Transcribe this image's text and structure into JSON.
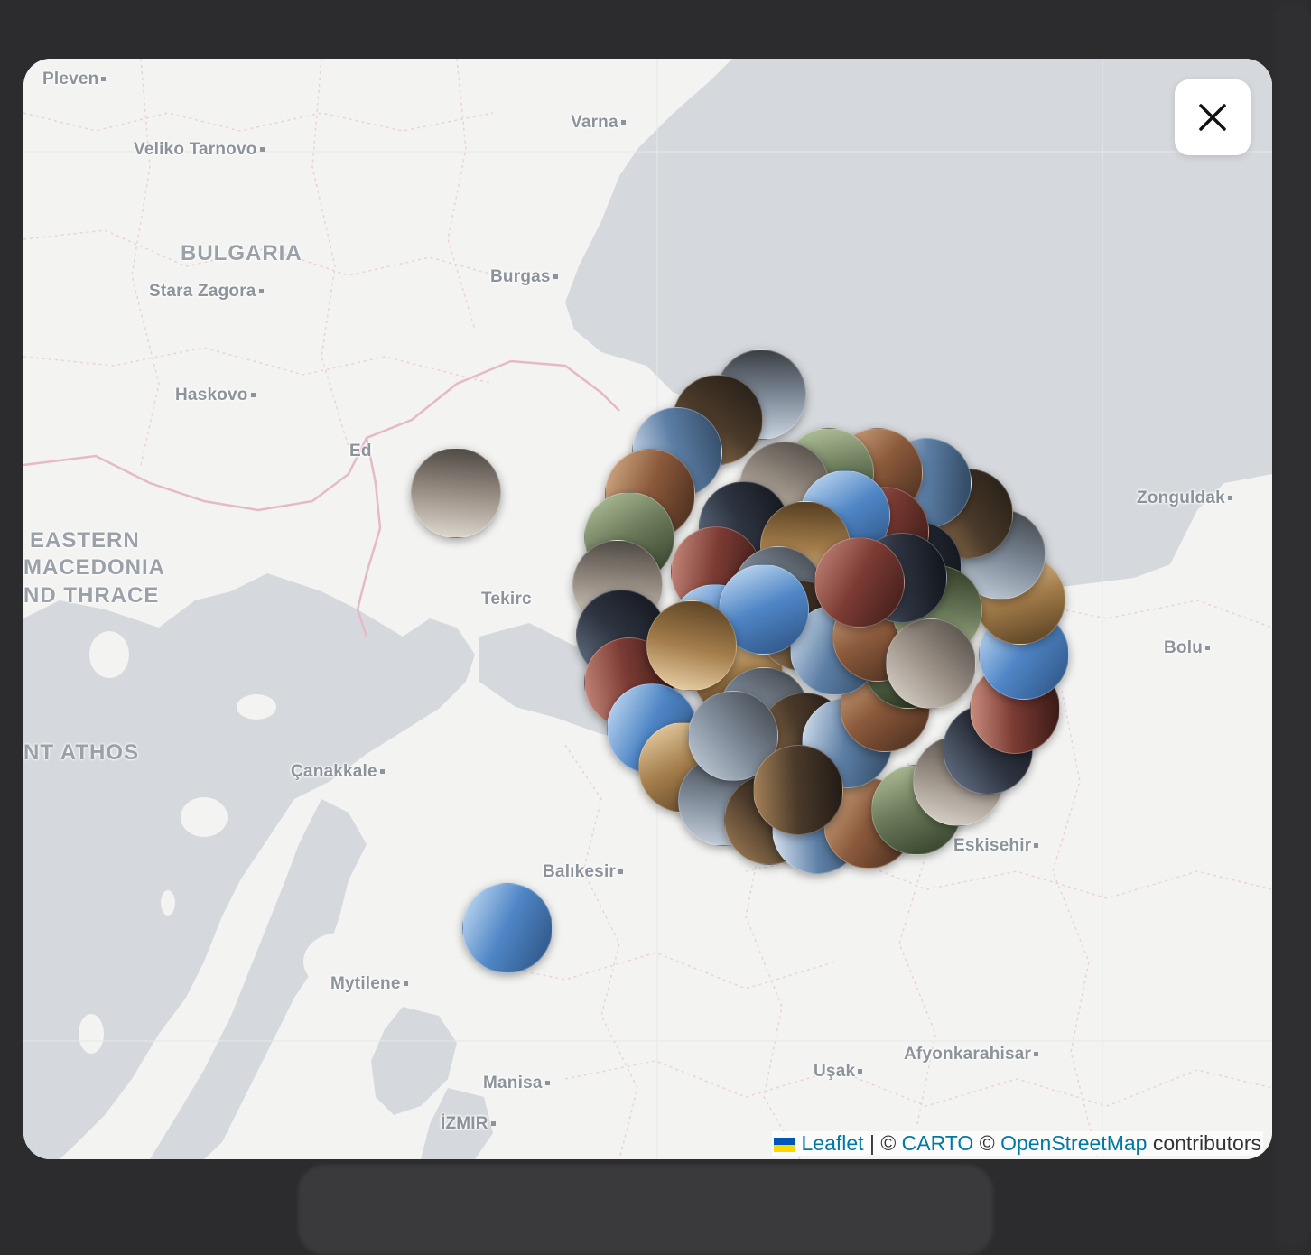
{
  "modal": {
    "close_label": "Close"
  },
  "map": {
    "cities": [
      {
        "key": "pleven",
        "name": "Pleven"
      },
      {
        "key": "varna",
        "name": "Varna"
      },
      {
        "key": "veliko",
        "name": "Veliko Tarnovo"
      },
      {
        "key": "burgas",
        "name": "Burgas"
      },
      {
        "key": "stara",
        "name": "Stara Zagora"
      },
      {
        "key": "haskovo",
        "name": "Haskovo"
      },
      {
        "key": "edirne",
        "name": "Ed"
      },
      {
        "key": "tekirdag",
        "name": "Tekirc"
      },
      {
        "key": "zonguldak",
        "name": "Zonguldak"
      },
      {
        "key": "bolu",
        "name": "Bolu"
      },
      {
        "key": "canakkale",
        "name": "Çanakkale"
      },
      {
        "key": "balikesir",
        "name": "Balıkesir"
      },
      {
        "key": "eskisehir",
        "name": "Eskisehir"
      },
      {
        "key": "mytilene",
        "name": "Mytilene"
      },
      {
        "key": "afyon",
        "name": "Afyonkarahisar"
      },
      {
        "key": "usak",
        "name": "Uşak"
      },
      {
        "key": "manisa",
        "name": "Manisa"
      },
      {
        "key": "izmir",
        "name": "İZMIR"
      }
    ],
    "regions": {
      "bulgaria": "BULGARIA",
      "eastern_macedonia": [
        "EASTERN",
        "MACEDONIA",
        "ND THRACE"
      ],
      "athos": "NT ATHOS"
    },
    "photo_markers": {
      "single_count": 2,
      "cluster_count": 52
    }
  },
  "attribution": {
    "leaflet": "Leaflet",
    "separator": "|",
    "copyright1": "©",
    "carto": "CARTO",
    "copyright2": "©",
    "osm": "OpenStreetMap",
    "suffix": "contributors"
  },
  "colors": {
    "water": "#d5d8dc",
    "land": "#f3f3f2",
    "border": "#e7b9c6",
    "label": "#8c939b",
    "link": "#0078a8"
  }
}
